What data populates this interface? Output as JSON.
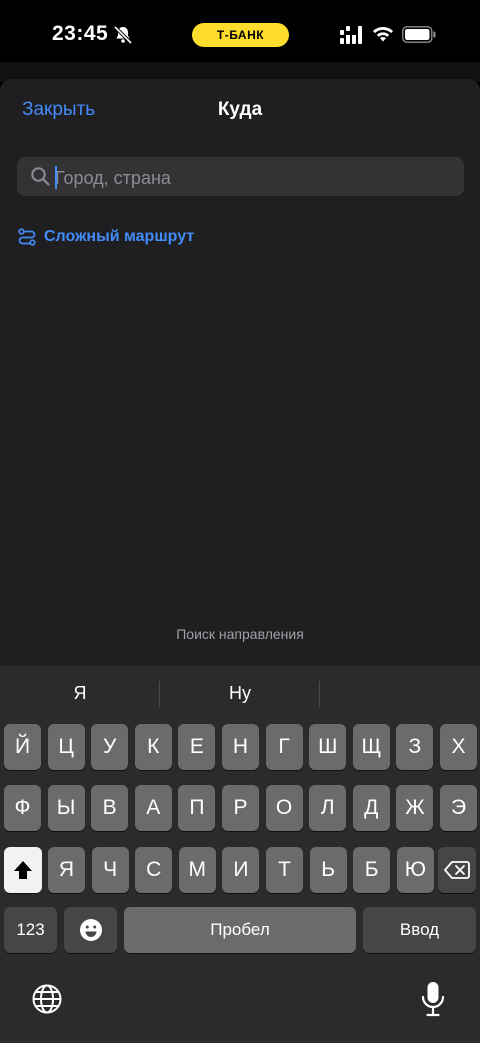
{
  "status_bar": {
    "time": "23:45",
    "bank_label": "Т-БАНК",
    "icons": [
      "bell-muted-icon",
      "signal-icon",
      "wifi-icon",
      "battery-icon"
    ]
  },
  "header": {
    "close_label": "Закрыть",
    "title": "Куда"
  },
  "search": {
    "placeholder": "Город, страна"
  },
  "complex_route": {
    "label": "Сложный маршрут"
  },
  "hint": "Поиск направления",
  "keyboard": {
    "suggestions": [
      "Я",
      "Ну",
      ""
    ],
    "row1": [
      "Й",
      "Ц",
      "У",
      "К",
      "Е",
      "Н",
      "Г",
      "Ш",
      "Щ",
      "З",
      "Х"
    ],
    "row2": [
      "Ф",
      "Ы",
      "В",
      "А",
      "П",
      "Р",
      "О",
      "Л",
      "Д",
      "Ж",
      "Э"
    ],
    "row3": [
      "Я",
      "Ч",
      "С",
      "М",
      "И",
      "Т",
      "Ь",
      "Б",
      "Ю"
    ],
    "numbers_label": "123",
    "space_label": "Пробел",
    "enter_label": "Ввод"
  },
  "colors": {
    "accent": "#428bf9",
    "bank_yellow": "#ffdd2d",
    "sheet_bg": "#1f1f21",
    "keyboard_bg": "#2b2b2d"
  }
}
